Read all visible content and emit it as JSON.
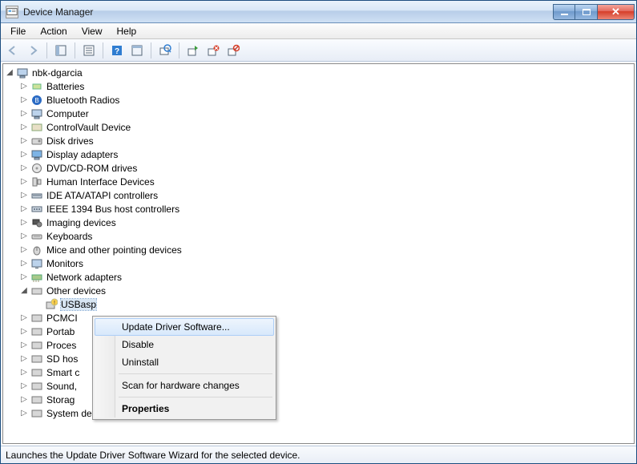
{
  "window": {
    "title": "Device Manager"
  },
  "menu": {
    "file": "File",
    "action": "Action",
    "view": "View",
    "help": "Help"
  },
  "tree": {
    "root": "nbk-dgarcia",
    "items": [
      "Batteries",
      "Bluetooth Radios",
      "Computer",
      "ControlVault Device",
      "Disk drives",
      "Display adapters",
      "DVD/CD-ROM drives",
      "Human Interface Devices",
      "IDE ATA/ATAPI controllers",
      "IEEE 1394 Bus host controllers",
      "Imaging devices",
      "Keyboards",
      "Mice and other pointing devices",
      "Monitors",
      "Network adapters"
    ],
    "other_devices": "Other devices",
    "usbasp": "USBasp",
    "after": [
      "PCMCI",
      "Portab",
      "Proces",
      "SD hos",
      "Smart c",
      "Sound,",
      "Storag",
      "System devices"
    ]
  },
  "context": {
    "update": "Update Driver Software...",
    "disable": "Disable",
    "uninstall": "Uninstall",
    "scan": "Scan for hardware changes",
    "properties": "Properties"
  },
  "status": "Launches the Update Driver Software Wizard for the selected device."
}
